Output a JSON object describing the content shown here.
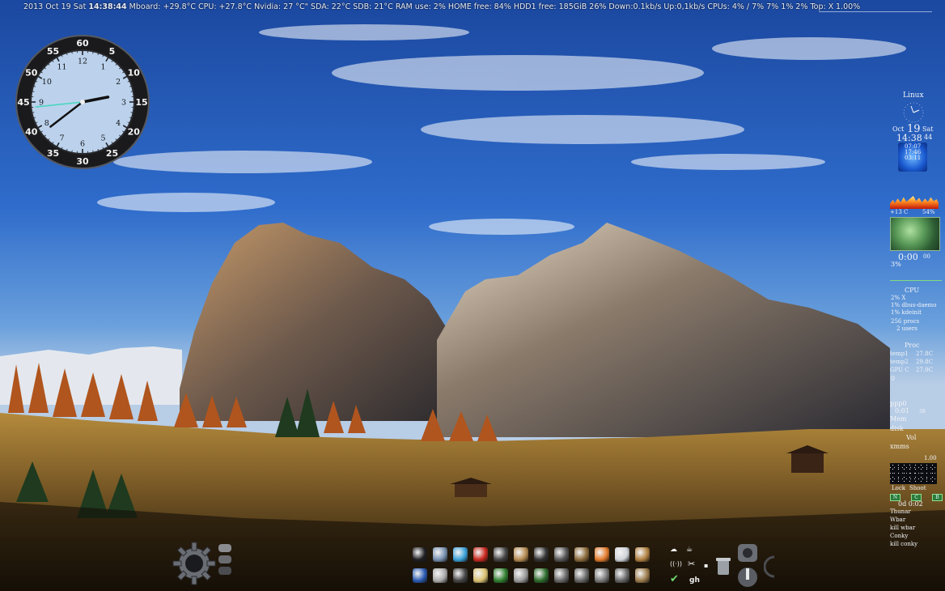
{
  "topbar": {
    "date": "2013 Oct 19 Sat",
    "time": "14:38:44",
    "stats": "Mboard:  +29.8°C CPU: +27.8°C Nvidia: 27 °C\" SDA:  22°C SDB:  21°C  RAM use: 2%  HOME free: 84%  HDD1 free: 185GiB 26% Down:0.1kb/s  Up:0,1kb/s  CPUs: 4% / 7% 7% 1% 2% Top: X",
    "percent": "1.00%"
  },
  "clock": {
    "minute_numerals": [
      "60",
      "5",
      "10",
      "15",
      "20",
      "25",
      "30",
      "35",
      "40",
      "45",
      "50",
      "55"
    ],
    "hour_numerals": [
      "12",
      "1",
      "2",
      "3",
      "4",
      "5",
      "6",
      "7",
      "8",
      "9",
      "10",
      "11"
    ],
    "hours": 2,
    "minutes": 38,
    "seconds": 44
  },
  "conky": {
    "os": "Linux",
    "date_prefix": "Oct",
    "day": "19",
    "weekday": "Sat",
    "time": "14:38",
    "seconds": "44",
    "moon_a": "07:07",
    "moon_b": "17:46",
    "moon_c": "03:11",
    "weather_temp": "+13 C",
    "weather_hum": "54%",
    "uptime": "0:00",
    "uptime_suffix": "00",
    "cpu_pct": "3%",
    "cpu_label": "CPU",
    "proc1": "2% X",
    "proc2": "1% dbus-daemo",
    "proc3": "1% kdeinit",
    "procs": "256 procs",
    "users": "2 users",
    "proc_label": "Proc",
    "temp1_label": "temp1",
    "temp1": "27.8C",
    "temp2_label": "temp2",
    "temp2": "29.8C",
    "gpu_label": "GPU C",
    "gpu": "27.0C",
    "zero": "0",
    "ppp": "ppp0",
    "ppp_time": "0:01",
    "ppp_val": "38",
    "mem": "Mem",
    "disk": "disk",
    "vol": "Vol",
    "xmms": "xmms",
    "xmms_val": "1.00",
    "lock": "Lock",
    "shoot": "Shoot",
    "btn_labels": [
      "N",
      "C",
      "B"
    ],
    "timer": "0d  0:02",
    "menu": [
      "Thunar",
      "Wbar",
      "kill wbar",
      "Conky",
      "kill conky"
    ]
  },
  "dock": {
    "icons": [
      "dark-globe-icon",
      "folder-icon",
      "monitor-icon",
      "pdf-icon",
      "pirate-icon",
      "gnu-icon",
      "drive-icon",
      "gear-icon",
      "wrench-icon",
      "firefox-icon",
      "cd-icon",
      "hammer-icon",
      "p-icon",
      "tools-icon",
      "device-icon",
      "pencil-icon",
      "terminal-icon",
      "pawprint-icon",
      "power-icon",
      "spiral-icon",
      "spider-icon",
      "aircraft-icon",
      "crossed-tools-icon",
      "box-icon"
    ],
    "colors": [
      "#1f1f22",
      "#7790b0",
      "#3aa0d8",
      "#c8281e",
      "#444",
      "#b48a50",
      "#333",
      "#555",
      "#8a6a3a",
      "#e27a2a",
      "#cfd3d8",
      "#b08040",
      "#2a5ab0",
      "#aaa",
      "#444",
      "#d9c070",
      "#2f7f2f",
      "#999",
      "#2c6b2c",
      "#666",
      "#666",
      "#777",
      "#666",
      "#9a7a4a"
    ]
  },
  "tray": {
    "wifi": "((·))",
    "scissors": "✂",
    "gh": "gh",
    "check": "✔"
  }
}
